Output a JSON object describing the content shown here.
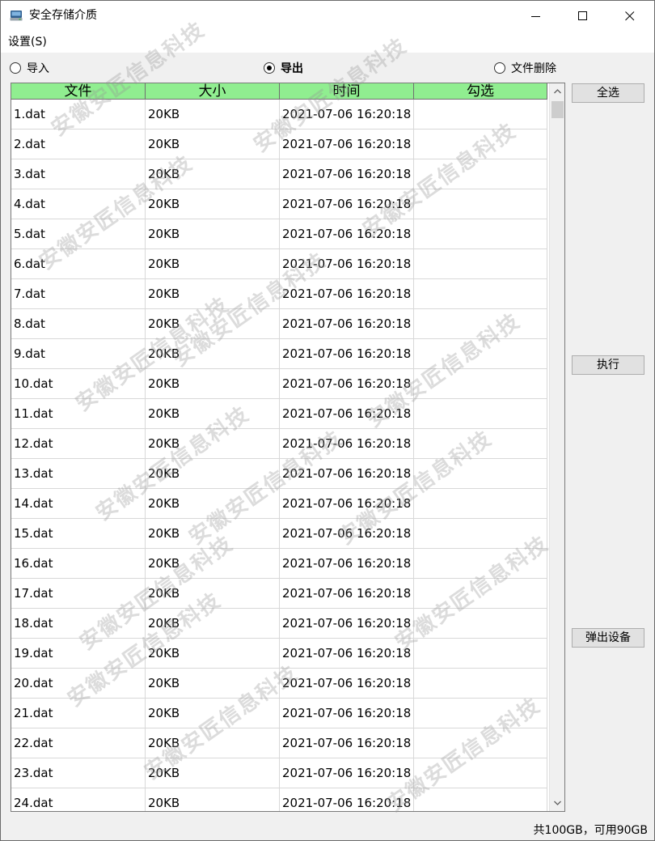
{
  "window": {
    "title": "安全存储介质",
    "icon": "storage-disk-icon"
  },
  "menu": {
    "settings": "设置(S)"
  },
  "modes": [
    {
      "label": "导入",
      "checked": false
    },
    {
      "label": "导出",
      "checked": true
    },
    {
      "label": "文件删除",
      "checked": false
    }
  ],
  "table": {
    "columns": [
      "文件",
      "大小",
      "时间",
      "勾选"
    ],
    "header_color": "#90ee90",
    "rows": [
      [
        "1.dat",
        "20KB",
        "2021-07-06 16:20:18",
        ""
      ],
      [
        "2.dat",
        "20KB",
        "2021-07-06 16:20:18",
        ""
      ],
      [
        "3.dat",
        "20KB",
        "2021-07-06 16:20:18",
        ""
      ],
      [
        "4.dat",
        "20KB",
        "2021-07-06 16:20:18",
        ""
      ],
      [
        "5.dat",
        "20KB",
        "2021-07-06 16:20:18",
        ""
      ],
      [
        "6.dat",
        "20KB",
        "2021-07-06 16:20:18",
        ""
      ],
      [
        "7.dat",
        "20KB",
        "2021-07-06 16:20:18",
        ""
      ],
      [
        "8.dat",
        "20KB",
        "2021-07-06 16:20:18",
        ""
      ],
      [
        "9.dat",
        "20KB",
        "2021-07-06 16:20:18",
        ""
      ],
      [
        "10.dat",
        "20KB",
        "2021-07-06 16:20:18",
        ""
      ],
      [
        "11.dat",
        "20KB",
        "2021-07-06 16:20:18",
        ""
      ],
      [
        "12.dat",
        "20KB",
        "2021-07-06 16:20:18",
        ""
      ],
      [
        "13.dat",
        "20KB",
        "2021-07-06 16:20:18",
        ""
      ],
      [
        "14.dat",
        "20KB",
        "2021-07-06 16:20:18",
        ""
      ],
      [
        "15.dat",
        "20KB",
        "2021-07-06 16:20:18",
        ""
      ],
      [
        "16.dat",
        "20KB",
        "2021-07-06 16:20:18",
        ""
      ],
      [
        "17.dat",
        "20KB",
        "2021-07-06 16:20:18",
        ""
      ],
      [
        "18.dat",
        "20KB",
        "2021-07-06 16:20:18",
        ""
      ],
      [
        "19.dat",
        "20KB",
        "2021-07-06 16:20:18",
        ""
      ],
      [
        "20.dat",
        "20KB",
        "2021-07-06 16:20:18",
        ""
      ],
      [
        "21.dat",
        "20KB",
        "2021-07-06 16:20:18",
        ""
      ],
      [
        "22.dat",
        "20KB",
        "2021-07-06 16:20:18",
        ""
      ],
      [
        "23.dat",
        "20KB",
        "2021-07-06 16:20:18",
        ""
      ],
      [
        "24.dat",
        "20KB",
        "2021-07-06 16:20:18",
        ""
      ]
    ]
  },
  "buttons": {
    "select_all": "全选",
    "execute": "执行",
    "eject": "弹出设备"
  },
  "status": "共100GB，可用90GB",
  "watermark": "安徽安匠信息科技"
}
